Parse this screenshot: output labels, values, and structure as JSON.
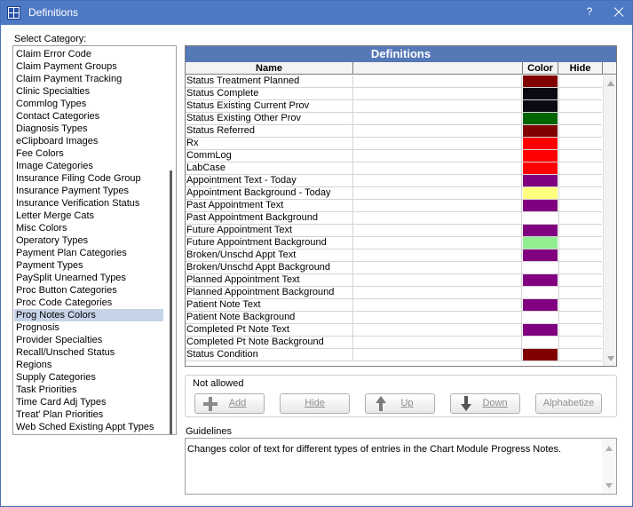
{
  "window": {
    "title": "Definitions",
    "help": "?"
  },
  "categories": {
    "label": "Select Category:",
    "items": [
      "Claim Error Code",
      "Claim Payment Groups",
      "Claim Payment Tracking",
      "Clinic Specialties",
      "Commlog Types",
      "Contact Categories",
      "Diagnosis Types",
      "eClipboard Images",
      "Fee Colors",
      "Image Categories",
      "Insurance Filing Code Group",
      "Insurance Payment Types",
      "Insurance Verification Status",
      "Letter Merge Cats",
      "Misc Colors",
      "Operatory Types",
      "Payment Plan Categories",
      "Payment Types",
      "PaySplit Unearned Types",
      "Proc Button Categories",
      "Proc Code Categories",
      "Prog Notes Colors",
      "Prognosis",
      "Provider Specialties",
      "Recall/Unsched Status",
      "Regions",
      "Supply Categories",
      "Task Priorities",
      "Time Card Adj Types",
      "Treat' Plan Priorities",
      "Web Sched Existing Appt Types"
    ],
    "selected": "Prog Notes Colors"
  },
  "grid": {
    "title": "Definitions",
    "columns": {
      "name": "Name",
      "color": "Color",
      "hide": "Hide"
    },
    "rows": [
      {
        "name": "Status Treatment Planned",
        "color": "#800000"
      },
      {
        "name": "Status Complete",
        "color": "#0a0a12"
      },
      {
        "name": "Status Existing Current Prov",
        "color": "#0a0a12"
      },
      {
        "name": "Status Existing Other Prov",
        "color": "#006400"
      },
      {
        "name": "Status Referred",
        "color": "#800000"
      },
      {
        "name": "Rx",
        "color": "#ff0000"
      },
      {
        "name": "CommLog",
        "color": "#ff0000"
      },
      {
        "name": "LabCase",
        "color": "#ff0000"
      },
      {
        "name": "Appointment Text - Today",
        "color": "#800080"
      },
      {
        "name": "Appointment Background - Today",
        "color": "#ffff80"
      },
      {
        "name": "Past Appointment Text",
        "color": "#800080"
      },
      {
        "name": "Past Appointment Background",
        "color": "#ffffff"
      },
      {
        "name": "Future Appointment Text",
        "color": "#800080"
      },
      {
        "name": "Future Appointment Background",
        "color": "#90ee90"
      },
      {
        "name": "Broken/Unschd Appt Text",
        "color": "#800080"
      },
      {
        "name": "Broken/Unschd Appt Background",
        "color": "#ffffff"
      },
      {
        "name": "Planned Appointment Text",
        "color": "#800080"
      },
      {
        "name": "Planned Appointment Background",
        "color": "#ffffff"
      },
      {
        "name": "Patient Note Text",
        "color": "#800080"
      },
      {
        "name": "Patient Note Background",
        "color": "#ffffff"
      },
      {
        "name": "Completed Pt Note Text",
        "color": "#800080"
      },
      {
        "name": "Completed Pt Note Background",
        "color": "#ffffff"
      },
      {
        "name": "Status Condition",
        "color": "#800000"
      }
    ]
  },
  "actions": {
    "group_label": "Not allowed",
    "add": "Add",
    "hide": "Hide",
    "up": "Up",
    "down": "Down",
    "alphabetize": "Alphabetize"
  },
  "guidelines": {
    "label": "Guidelines",
    "text": "Changes color of text for different types of entries in the Chart Module Progress Notes."
  }
}
